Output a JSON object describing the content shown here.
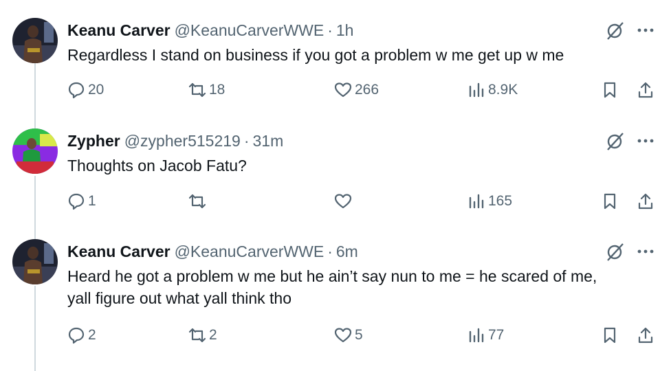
{
  "tweets": [
    {
      "name": "Keanu Carver",
      "handle": "@KeanuCarverWWE",
      "separator": "·",
      "time": "1h",
      "text_lines": [
        "Regardless I stand on business if you got a problem w me get up w me"
      ],
      "replies": "20",
      "reposts": "18",
      "likes": "266",
      "views": "8.9K"
    },
    {
      "name": "Zypher",
      "handle": "@zypher515219",
      "separator": "·",
      "time": "31m",
      "text_lines": [
        "Thoughts on Jacob Fatu?"
      ],
      "replies": "1",
      "reposts": "",
      "likes": "",
      "views": "165"
    },
    {
      "name": "Keanu Carver",
      "handle": "@KeanuCarverWWE",
      "separator": "·",
      "time": "6m",
      "text_lines": [
        "Heard he got a problem w me but he ain’t say nun to me = he scared of me,",
        "yall figure out what yall think tho"
      ],
      "replies": "2",
      "reposts": "2",
      "likes": "5",
      "views": "77"
    }
  ],
  "icons": {
    "reply": "reply-icon",
    "repost": "repost-icon",
    "like": "like-icon",
    "views": "views-icon",
    "bookmark": "bookmark-icon",
    "share": "share-icon",
    "mute": "mute-icon",
    "more": "more-icon"
  },
  "colors": {
    "text": "#0f1419",
    "secondary": "#536471",
    "thread_line": "#cfd9de"
  }
}
